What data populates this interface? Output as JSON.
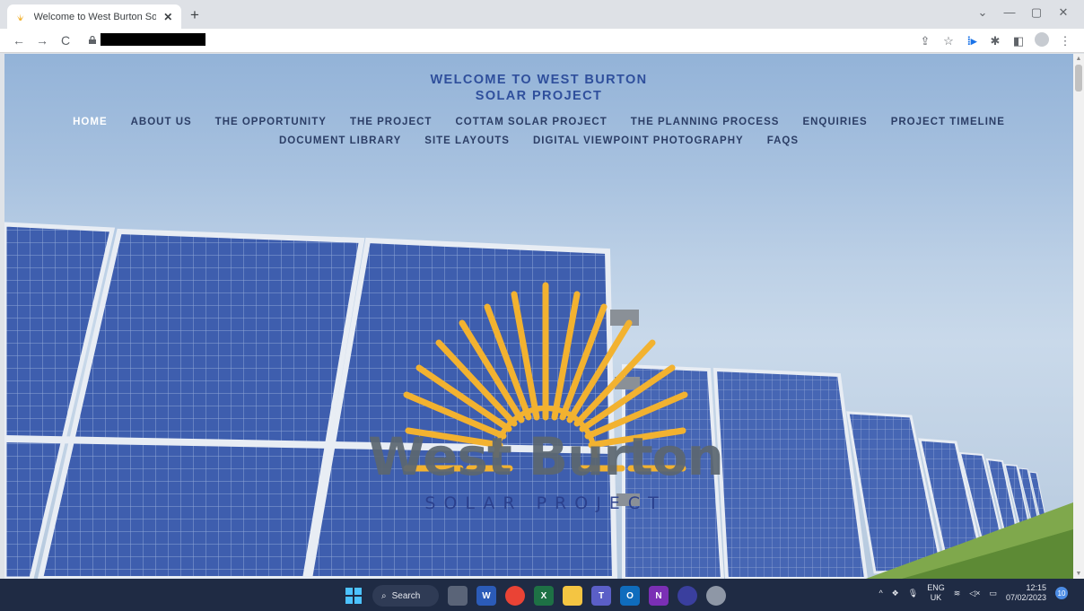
{
  "browser": {
    "tab_title": "Welcome to West Burton Solar P",
    "tab_close": "✕",
    "new_tab": "+",
    "window_controls": [
      "⌄",
      "—",
      "▢",
      "✕"
    ],
    "nav": {
      "back": "←",
      "forward": "→",
      "reload": "C"
    },
    "toolbar_icons": [
      "share-icon",
      "star-icon",
      "extension-icon",
      "puzzle-icon",
      "sidebar-icon",
      "profile-icon",
      "menu-icon"
    ]
  },
  "page": {
    "title_line1": "WELCOME TO WEST BURTON",
    "title_line2": "SOLAR PROJECT",
    "nav_row1": [
      {
        "label": "HOME",
        "active": true
      },
      {
        "label": "ABOUT US",
        "active": false
      },
      {
        "label": "THE OPPORTUNITY",
        "active": false
      },
      {
        "label": "THE PROJECT",
        "active": false
      },
      {
        "label": "COTTAM SOLAR PROJECT",
        "active": false
      },
      {
        "label": "THE PLANNING PROCESS",
        "active": false
      },
      {
        "label": "ENQUIRIES",
        "active": false
      },
      {
        "label": "PROJECT TIMELINE",
        "active": false
      }
    ],
    "nav_row2": [
      {
        "label": "DOCUMENT LIBRARY",
        "active": false
      },
      {
        "label": "SITE LAYOUTS",
        "active": false
      },
      {
        "label": "DIGITAL VIEWPOINT PHOTOGRAPHY",
        "active": false
      },
      {
        "label": "FAQS",
        "active": false
      }
    ],
    "logo_word": "West Burton",
    "logo_sub": "SOLAR PROJECT"
  },
  "colors": {
    "title": "#2f4f9c",
    "nav": "#2c3e66",
    "nav_active": "#ffffff",
    "sun": "#f2b230",
    "panel": "#3f5fb0"
  },
  "taskbar": {
    "search_label": "Search",
    "lang_line1": "ENG",
    "lang_line2": "UK",
    "time": "12:15",
    "date": "07/02/2023",
    "notification_count": "10"
  }
}
